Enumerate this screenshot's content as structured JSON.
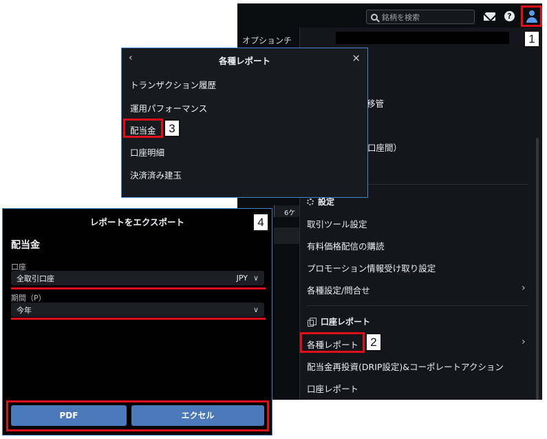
{
  "header": {
    "search_placeholder": "銘柄を検索",
    "option_tab": "オプションチ",
    "period_button": "6ケ"
  },
  "account_menu": {
    "partial_items": [
      "移管",
      "口座間）"
    ],
    "settings_section": "設定",
    "settings_items": [
      {
        "label": "取引ツール設定",
        "has_arrow": false
      },
      {
        "label": "有料価格配信の購読",
        "has_arrow": false
      },
      {
        "label": "プロモーション情報受け取り設定",
        "has_arrow": false
      },
      {
        "label": "各種設定/問合せ",
        "has_arrow": true
      }
    ],
    "reports_section": "口座レポート",
    "report_items": [
      {
        "label": "各種レポート",
        "has_arrow": true
      },
      {
        "label": "配当金再投資(DRIP設定)&コーポレートアクション",
        "has_arrow": false
      },
      {
        "label": "口座レポート",
        "has_arrow": false
      }
    ]
  },
  "reports_panel": {
    "title": "各種レポート",
    "back_glyph": "‹",
    "close_glyph": "×",
    "items": [
      "トランザクション履歴",
      "運用パフォーマンス",
      "配当金",
      "口座明細",
      "決済済み建玉"
    ]
  },
  "export_dialog": {
    "title": "レポートをエクスポート",
    "heading": "配当金",
    "account_label": "口座",
    "account_value": "全取引口座",
    "currency": "JPY",
    "period_label": "期間（P）",
    "period_value": "今年",
    "pdf_button": "PDF",
    "excel_button": "エクセル"
  },
  "callouts": {
    "one": "1",
    "two": "2",
    "three": "3",
    "four": "4"
  },
  "colors": {
    "highlight": "#e0101a",
    "panel_border": "#4683c7",
    "button": "#4a78b8",
    "user_icon": "#5b9ae8"
  }
}
